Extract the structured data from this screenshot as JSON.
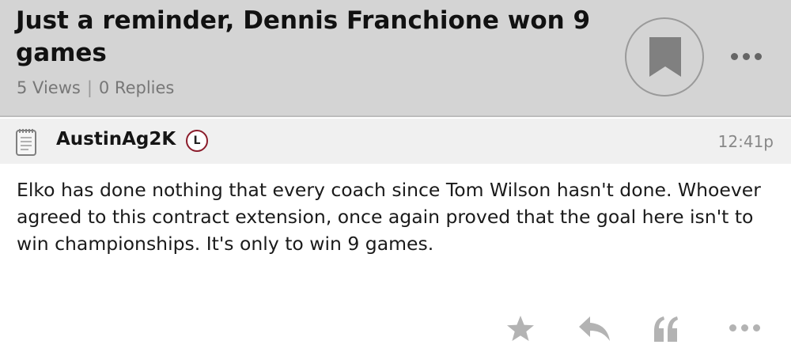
{
  "thread": {
    "title": "Just a reminder, Dennis Franchione won 9 games",
    "views": "5 Views",
    "replies": "0 Replies",
    "separator": "|"
  },
  "post": {
    "author": "AustinAg2K",
    "badge": "L",
    "time": "12:41p",
    "body": "Elko has done nothing that every coach since Tom Wilson hasn't done. Whoever agreed to this contract extension, once again proved that the goal here isn't to win championships. It's only to win 9 games."
  },
  "icons": {
    "bookmark": "bookmark-icon",
    "more": "more-dots-icon",
    "post_type": "notepad-icon",
    "star": "star-icon",
    "reply": "reply-arrow-icon",
    "quote": "quote-icon"
  },
  "colors": {
    "header_bg": "#d4d4d4",
    "post_header_bg": "#f0f0f0",
    "badge_ring": "#8b1c2b",
    "action_icons": "#b3b3b3"
  }
}
